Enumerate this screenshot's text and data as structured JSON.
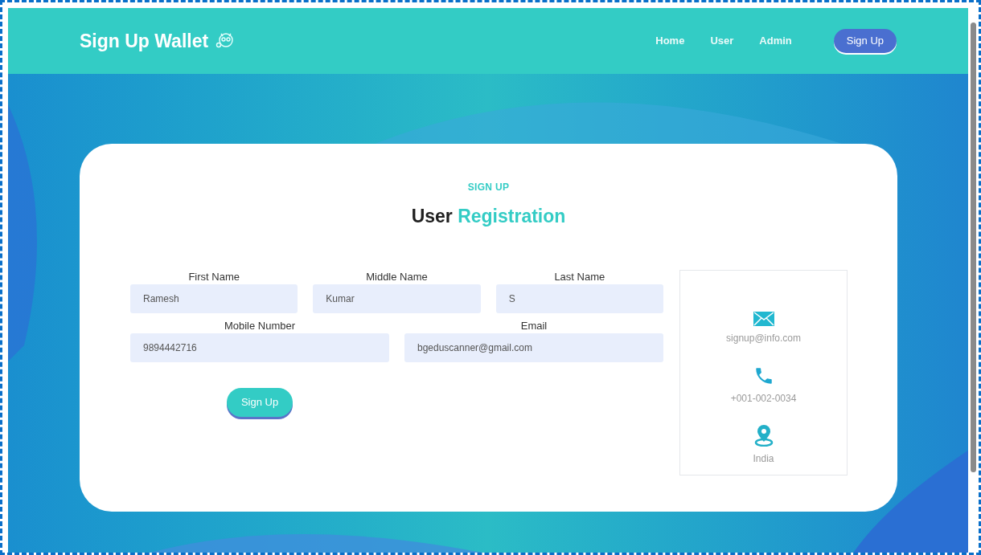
{
  "brand": {
    "title": "Sign Up Wallet"
  },
  "nav": [
    {
      "label": "Home",
      "kind": "link"
    },
    {
      "label": "User",
      "kind": "link"
    },
    {
      "label": "Admin",
      "kind": "link"
    },
    {
      "label": "Sign Up",
      "kind": "button"
    }
  ],
  "form": {
    "eyebrow": "SIGN UP",
    "title_first": "User",
    "title_accent": "Registration",
    "rows": [
      [
        {
          "label": "First Name",
          "value": "Ramesh"
        },
        {
          "label": "Middle Name",
          "value": "Kumar"
        },
        {
          "label": "Last Name",
          "value": "S"
        }
      ],
      [
        {
          "label": "Mobile Number",
          "value": "9894442716"
        },
        {
          "label": "Email",
          "value": "bgeduscanner@gmail.com"
        }
      ]
    ],
    "submit": "Sign Up"
  },
  "contact": [
    {
      "kind": "email",
      "text": "signup@info.com"
    },
    {
      "kind": "phone",
      "text": "+001-002-0034"
    },
    {
      "kind": "location",
      "text": "India"
    }
  ]
}
